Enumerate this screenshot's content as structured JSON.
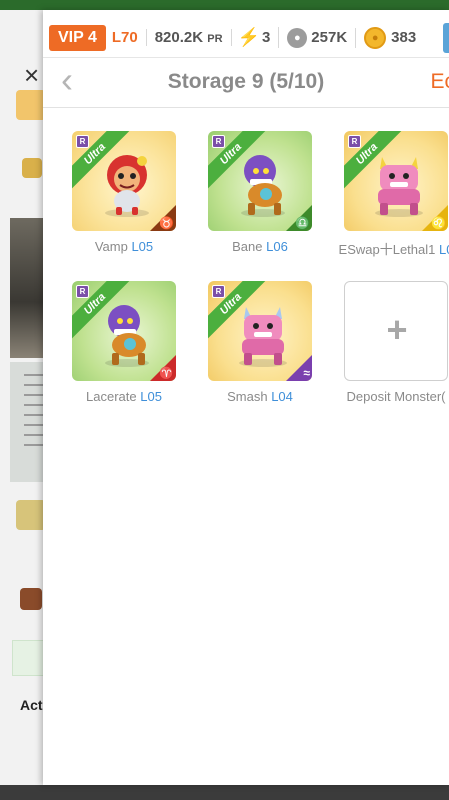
{
  "status_bar": {
    "vip": "VIP 4",
    "level": "L70",
    "power_value": "820.2K",
    "power_unit": "PR",
    "energy": "3",
    "food": "257K",
    "gold": "383"
  },
  "header": {
    "title": "Storage 9 (5/10)",
    "edit_label": "Ec",
    "back_icon": "chevron-left-icon"
  },
  "slots": [
    {
      "name": "Vamp",
      "level": "L05",
      "rank": "R",
      "rarity": "Ultra",
      "background": "gold",
      "sign_glyph": "♉",
      "sign_color": "#8a3a12"
    },
    {
      "name": "Bane",
      "level": "L06",
      "rank": "R",
      "rarity": "Ultra",
      "background": "green",
      "sign_glyph": "♎",
      "sign_color": "#3d8a2a"
    },
    {
      "name": "ESwap十Lethal1",
      "level": "L0",
      "rank": "R",
      "rarity": "Ultra",
      "background": "pink",
      "sign_glyph": "♌",
      "sign_color": "#e6b40f"
    },
    {
      "name": "Lacerate",
      "level": "L05",
      "rank": "R",
      "rarity": "Ultra",
      "background": "green",
      "sign_glyph": "♈",
      "sign_color": "#cc2a2a"
    },
    {
      "name": "Smash",
      "level": "L04",
      "rank": "R",
      "rarity": "Ultra",
      "background": "pink",
      "sign_glyph": "≈",
      "sign_color": "#7a3fae"
    }
  ],
  "deposit": {
    "label": "Deposit Monster(",
    "plus": "+"
  },
  "background_app": {
    "close_icon": "×",
    "section_label": "Act"
  },
  "colors": {
    "accent": "#ee6b25",
    "level_blue": "#3f8fd9",
    "ultra_ribbon": "#4caf3e"
  }
}
